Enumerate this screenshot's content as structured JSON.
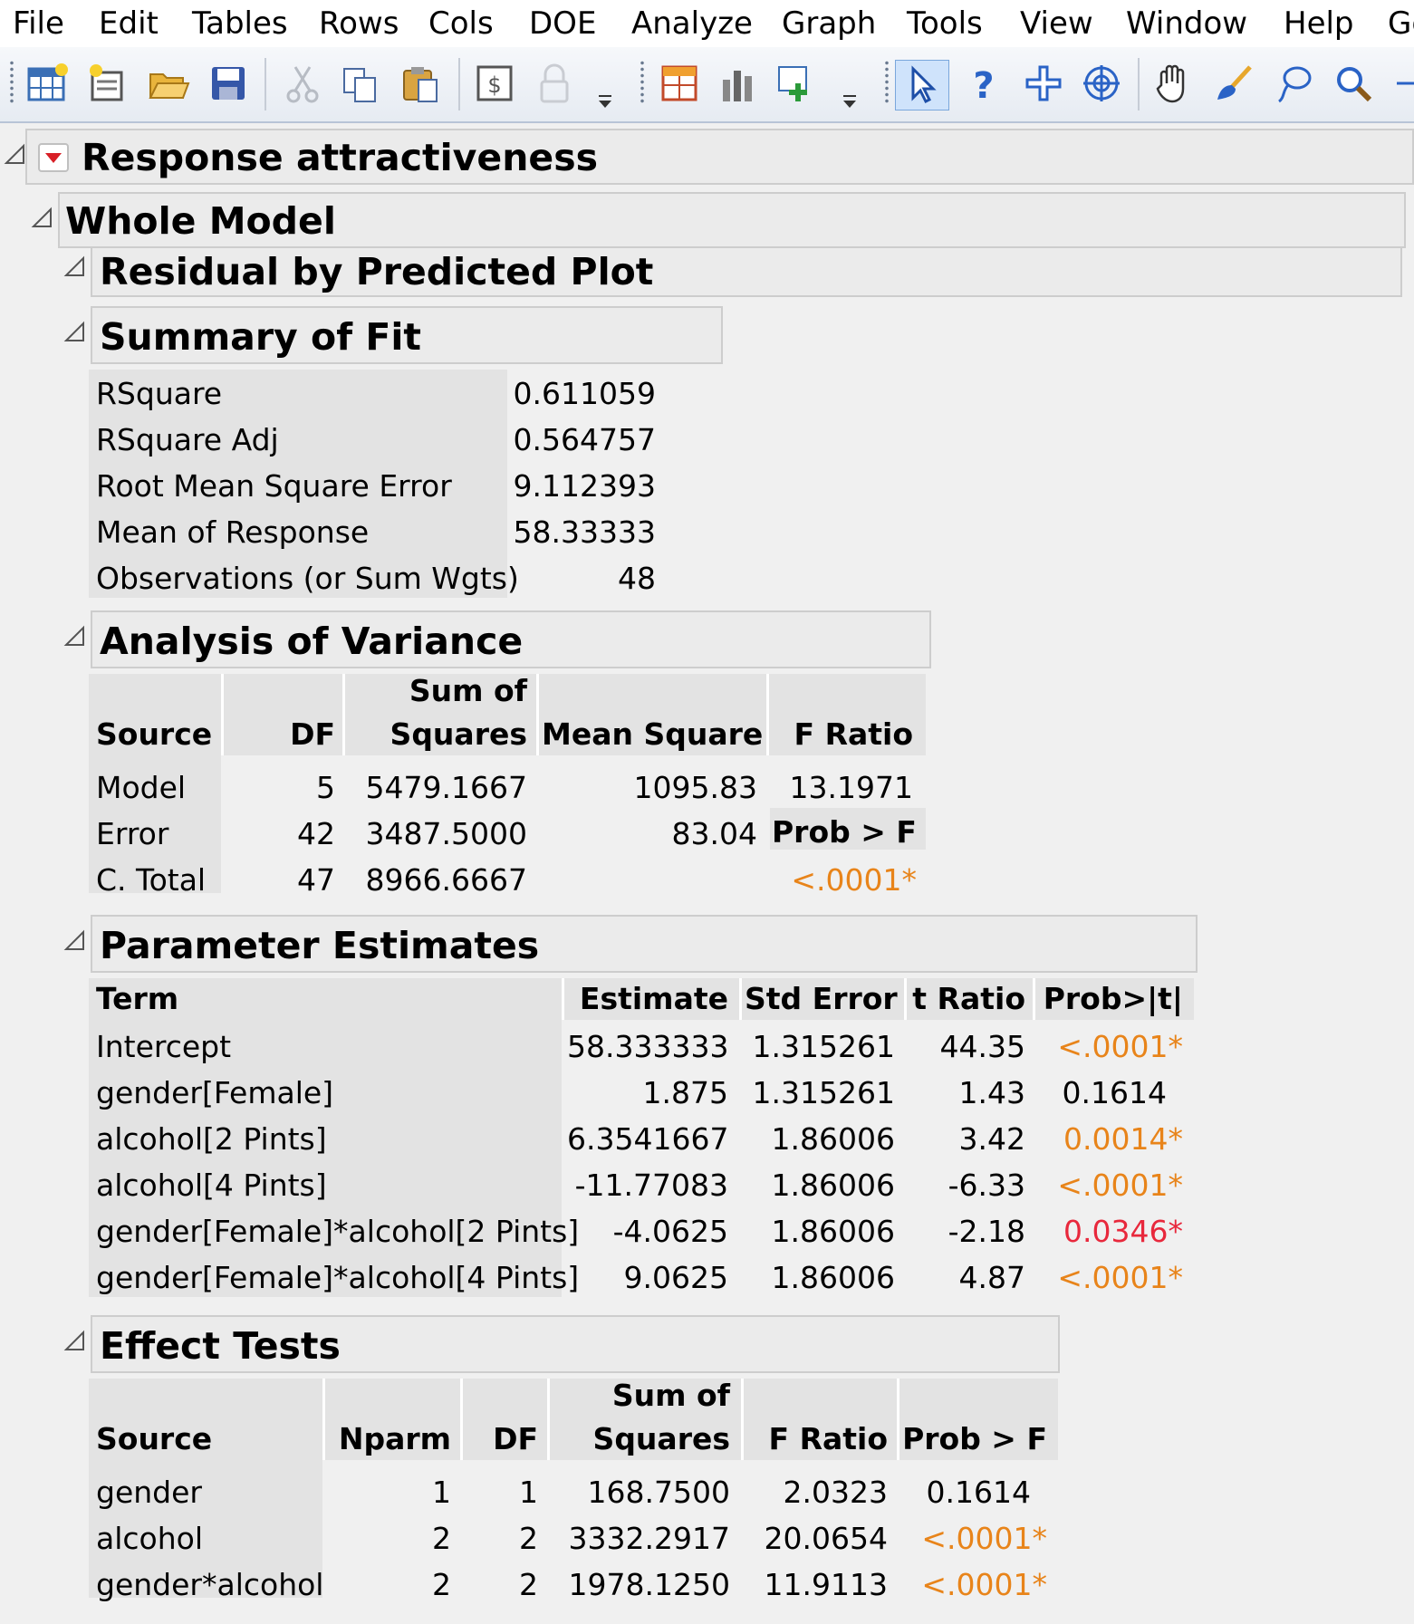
{
  "menu": [
    "File",
    "Edit",
    "Tables",
    "Rows",
    "Cols",
    "DOE",
    "Analyze",
    "Graph",
    "Tools",
    "View",
    "Window",
    "Help",
    "Ge"
  ],
  "toolbar": {
    "icons": [
      "new-data-table-icon",
      "new-script-icon",
      "open-file-icon",
      "save-icon",
      "cut-icon",
      "copy-icon",
      "paste-icon",
      "clipboard-icon",
      "lock-icon",
      "more-icon",
      "tabulate-icon",
      "distribution-icon",
      "add-rows-icon",
      "more-icon",
      "arrow-tool-icon",
      "help-icon",
      "crosshair-icon",
      "selection-icon",
      "hand-icon",
      "brush-icon",
      "lasso-icon",
      "magnifier-icon"
    ]
  },
  "report": {
    "title": "Response attractiveness",
    "whole_model": "Whole Model",
    "residual_plot": "Residual by Predicted Plot",
    "summary_of_fit": {
      "title": "Summary of Fit",
      "rows": [
        {
          "label": "RSquare",
          "value": "0.611059"
        },
        {
          "label": "RSquare Adj",
          "value": "0.564757"
        },
        {
          "label": "Root Mean Square Error",
          "value": "9.112393"
        },
        {
          "label": "Mean of Response",
          "value": "58.33333"
        },
        {
          "label": "Observations (or Sum Wgts)",
          "value": "48"
        }
      ]
    },
    "anova": {
      "title": "Analysis of Variance",
      "headers": {
        "source": "Source",
        "df": "DF",
        "ss_1": "Sum of",
        "ss_2": "Squares",
        "ms": "Mean Square",
        "f": "F Ratio",
        "prob": "Prob > F"
      },
      "rows": [
        {
          "source": "Model",
          "df": "5",
          "ss": "5479.1667",
          "ms": "1095.83",
          "f": "13.1971"
        },
        {
          "source": "Error",
          "df": "42",
          "ss": "3487.5000",
          "ms": "83.04"
        },
        {
          "source": "C. Total",
          "df": "47",
          "ss": "8966.6667",
          "prob": "<.0001*"
        }
      ]
    },
    "params": {
      "title": "Parameter Estimates",
      "headers": {
        "term": "Term",
        "estimate": "Estimate",
        "stderr": "Std Error",
        "t": "t Ratio",
        "prob": "Prob>|t|"
      },
      "rows": [
        {
          "term": "Intercept",
          "estimate": "58.333333",
          "stderr": "1.315261",
          "t": "44.35",
          "prob": "<.0001*"
        },
        {
          "term": "gender[Female]",
          "estimate": "1.875",
          "stderr": "1.315261",
          "t": "1.43",
          "prob": "0.1614"
        },
        {
          "term": "alcohol[2 Pints]",
          "estimate": "6.3541667",
          "stderr": "1.86006",
          "t": "3.42",
          "prob": "0.0014*"
        },
        {
          "term": "alcohol[4 Pints]",
          "estimate": "-11.77083",
          "stderr": "1.86006",
          "t": "-6.33",
          "prob": "<.0001*"
        },
        {
          "term": "gender[Female]*alcohol[2 Pints]",
          "estimate": "-4.0625",
          "stderr": "1.86006",
          "t": "-2.18",
          "prob": "0.0346*"
        },
        {
          "term": "gender[Female]*alcohol[4 Pints]",
          "estimate": "9.0625",
          "stderr": "1.86006",
          "t": "4.87",
          "prob": "<.0001*"
        }
      ]
    },
    "effects": {
      "title": "Effect Tests",
      "headers": {
        "source": "Source",
        "nparm": "Nparm",
        "df": "DF",
        "ss_1": "Sum of",
        "ss_2": "Squares",
        "f": "F Ratio",
        "prob": "Prob > F"
      },
      "rows": [
        {
          "source": "gender",
          "nparm": "1",
          "df": "1",
          "ss": "168.7500",
          "f": "2.0323",
          "prob": "0.1614"
        },
        {
          "source": "alcohol",
          "nparm": "2",
          "df": "2",
          "ss": "3332.2917",
          "f": "20.0654",
          "prob": "<.0001*"
        },
        {
          "source": "gender*alcohol",
          "nparm": "2",
          "df": "2",
          "ss": "1978.1250",
          "f": "11.9113",
          "prob": "<.0001*"
        }
      ]
    }
  },
  "colors": {
    "significant": "#e8841a",
    "marginal": "#e8283c"
  }
}
